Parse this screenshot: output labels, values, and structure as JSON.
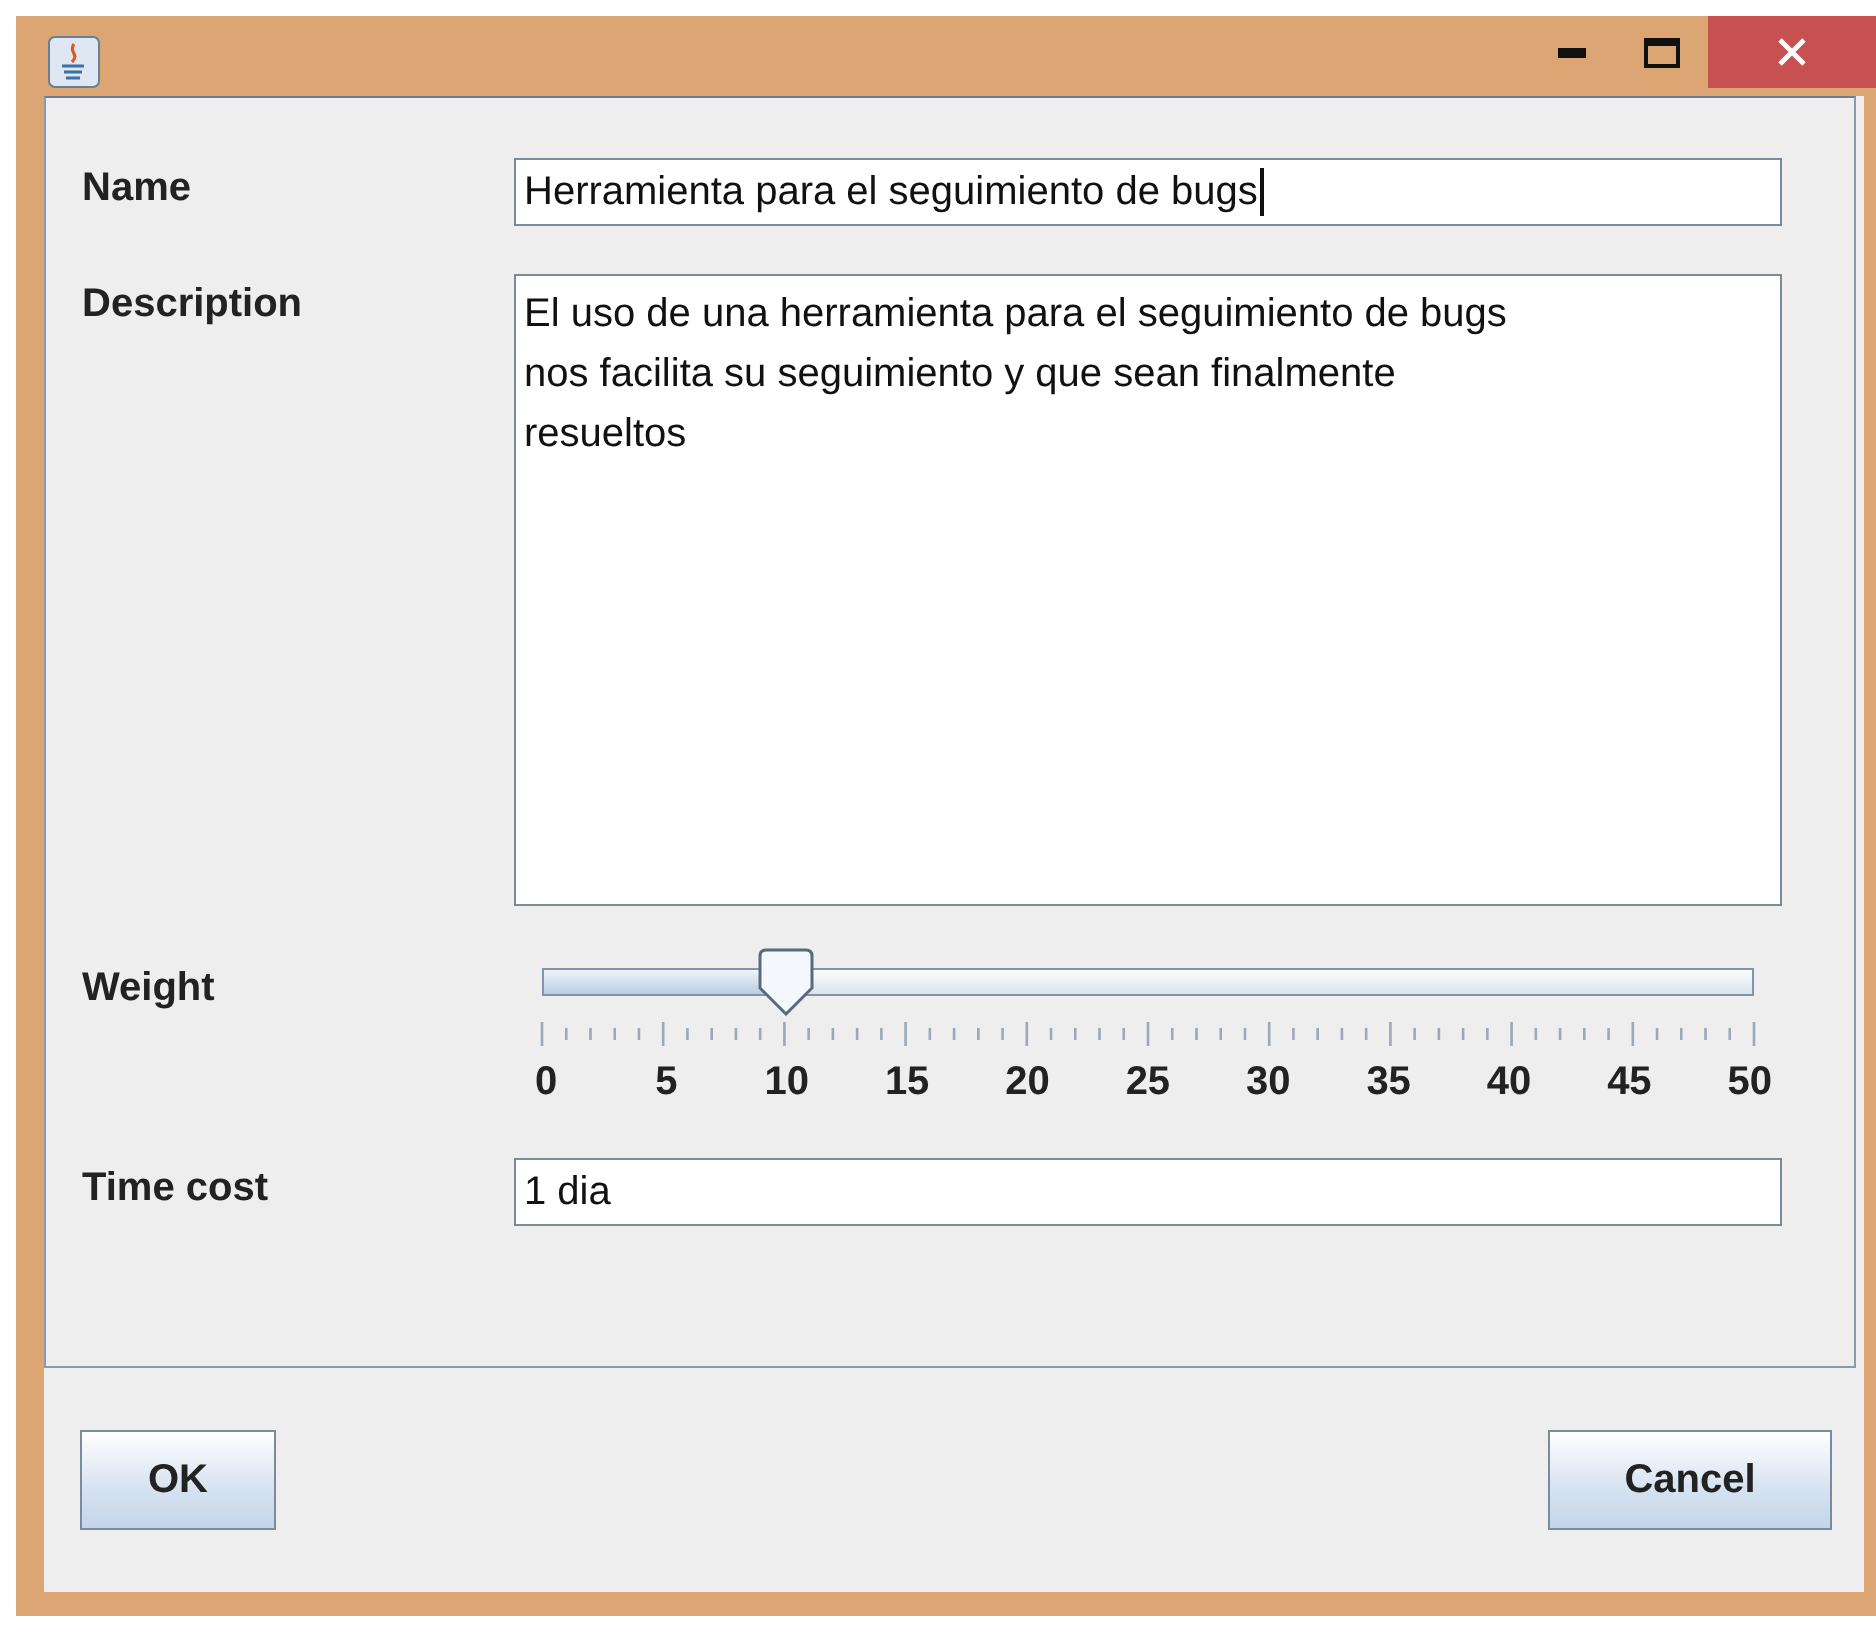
{
  "fields": [
    {
      "kind": "text",
      "label": "Name",
      "value": "Herramienta para el seguimiento de bugs",
      "focused": true
    },
    {
      "kind": "area",
      "label": "Description",
      "value": "El uso de una herramienta para el seguimiento de bugs nos facilita su seguimiento y que sean finalmente resueltos"
    },
    {
      "kind": "slider",
      "label": "Weight",
      "level": 0.2,
      "tick_labels": [
        "0",
        "5",
        "10",
        "15",
        "20",
        "25",
        "30",
        "35",
        "40",
        "45",
        "50"
      ]
    },
    {
      "kind": "text",
      "label": "Time cost",
      "value": "1 dia",
      "focused": false
    }
  ],
  "buttons": [
    {
      "label": "OK"
    },
    {
      "label": "Cancel"
    }
  ]
}
